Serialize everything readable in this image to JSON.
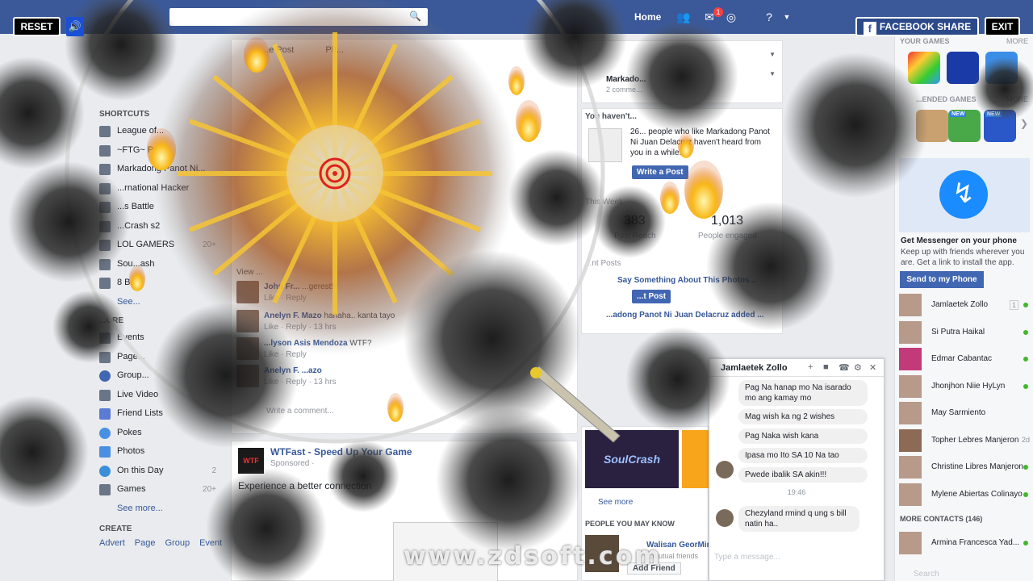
{
  "game": {
    "reset_label": "RESET",
    "share_label": "FACEBOOK SHARE",
    "exit_label": "EXIT",
    "sound_icon": "speaker-icon",
    "target_icon": "crosshair-target-icon"
  },
  "topbar": {
    "home_label": "Home",
    "notification_count": "1",
    "color": "#3b5998"
  },
  "left_nav": {
    "shortcuts_heading": "SHORTCUTS",
    "shortcuts": [
      {
        "label": "League of..."
      },
      {
        "label": "~FTG~ P..."
      },
      {
        "label": "Markadong Panot Ni..."
      },
      {
        "label": "...rnational Hacker"
      },
      {
        "label": "...s Battle"
      },
      {
        "label": "...Crash s2"
      },
      {
        "label": "LOL GAMERS",
        "count": "20+"
      },
      {
        "label": "Sou...ash"
      },
      {
        "label": "8 B..."
      }
    ],
    "shortcuts_see_more": "See...",
    "explore_heading": "...ORE",
    "explore": [
      {
        "label": "Events"
      },
      {
        "label": "Page..."
      },
      {
        "label": "Group..."
      },
      {
        "label": "Live Video"
      },
      {
        "label": "Friend Lists"
      },
      {
        "label": "Pokes"
      },
      {
        "label": "Photos"
      },
      {
        "label": "On this Day",
        "count": "2"
      },
      {
        "label": "Games",
        "count": "20+"
      }
    ],
    "explore_see_more": "See more...",
    "create_heading": "CREATE",
    "create_links": [
      "Advert",
      "Page",
      "Group",
      "Event"
    ]
  },
  "feed": {
    "post_buttons": [
      "...e Post",
      "Ph..."
    ],
    "view_more": "View ...",
    "comments": [
      {
        "name": "John Fr...",
        "text": "...gerest!!!",
        "meta": "Like · Reply"
      },
      {
        "name": "Anelyn F. Mazo",
        "text": "hahaha.. kanta tayo",
        "meta": "Like · Reply · 13 hrs"
      },
      {
        "name": "...lyson Asis Mendoza",
        "text": "WTF?",
        "meta": "Like · Reply"
      },
      {
        "name": "Anelyn F. ...azo",
        "text": "",
        "meta": "Like · Reply · 13 hrs"
      }
    ],
    "write_comment": "Write a comment...",
    "ad": {
      "title": "WTFast - Speed Up Your Game",
      "sponsored": "Sponsored · ",
      "text": "Experience a better connection",
      "logo_text": "WTF"
    }
  },
  "right_col": {
    "page_name": "Markado...",
    "comments_link": "2 comme...",
    "you_havent": "You haven't...",
    "reach_text": "26... people who like Markadong Panot Ni Juan Delacruz haven't heard from you in a while.",
    "write_post": "Write a Post",
    "this_week": "This Week",
    "post_reach_value": "383",
    "post_reach_label": "Post Reach",
    "engaged_value": "1,013",
    "engaged_label": "People engaged",
    "recent_posts": "...nt Posts",
    "recent_post_title": "Say Something About This Photos...",
    "boost_label": "...t Post",
    "added_text": "...adong Panot Ni Juan Delacruz added ...",
    "see_more": "See more",
    "pymk_heading": "PEOPLE YOU MAY KNOW",
    "pymk_name": "Walisan GeorMina",
    "pymk_mutual": "...mutual friends",
    "add_friend": "Add Friend",
    "game_ad_text": "SoulCrash"
  },
  "chat": {
    "name": "Jamlaetek Zollo",
    "messages": [
      "Pag Na hanap mo Na isarado mo ang kamay mo",
      "Mag wish ka ng 2 wishes",
      "Pag Naka wish kana",
      "Ipasa mo Ito SA 10 Na tao",
      "Pwede ibalik SA akin!!!"
    ],
    "time": "19:46",
    "last_message": "Chezyland rmind q ung s bill natin ha..",
    "input_placeholder": "Type a message..."
  },
  "sidebar": {
    "your_games": "YOUR GAMES",
    "more_1": "MORE",
    "recommended": "...ENDED GAMES",
    "more_2": "MORE",
    "new_badge": "NEW",
    "messenger_title": "Get Messenger on your phone",
    "messenger_text": "Keep up with friends wherever you are. Get a link to install the app.",
    "send_button": "Send to my Phone",
    "contacts": [
      {
        "name": "Jamlaetek Zollo",
        "extra": "1",
        "online": true
      },
      {
        "name": "Si Putra Haikal",
        "extra": "",
        "online": true
      },
      {
        "name": "Edmar Cabantac",
        "extra": "",
        "online": true
      },
      {
        "name": "Jhonjhon Niie HyLyn",
        "extra": "",
        "online": true
      },
      {
        "name": "May Sarmiento",
        "extra": "",
        "online": false
      },
      {
        "name": "Topher Lebres Manjeron",
        "extra": "2d",
        "online": false
      },
      {
        "name": "Christine Libres Manjeron",
        "extra": "",
        "online": true
      },
      {
        "name": "Mylene Abiertas Colinayo",
        "extra": "",
        "online": true
      }
    ],
    "more_contacts": "MORE CONTACTS (146)",
    "more_contacts_first": "Armina Francesca Yad...",
    "search_placeholder": "Search"
  },
  "watermark": "www.zdsoft.com",
  "colors": {
    "fb_blue": "#3b5998",
    "button_blue": "#4267b2",
    "online_green": "#42b72a"
  }
}
